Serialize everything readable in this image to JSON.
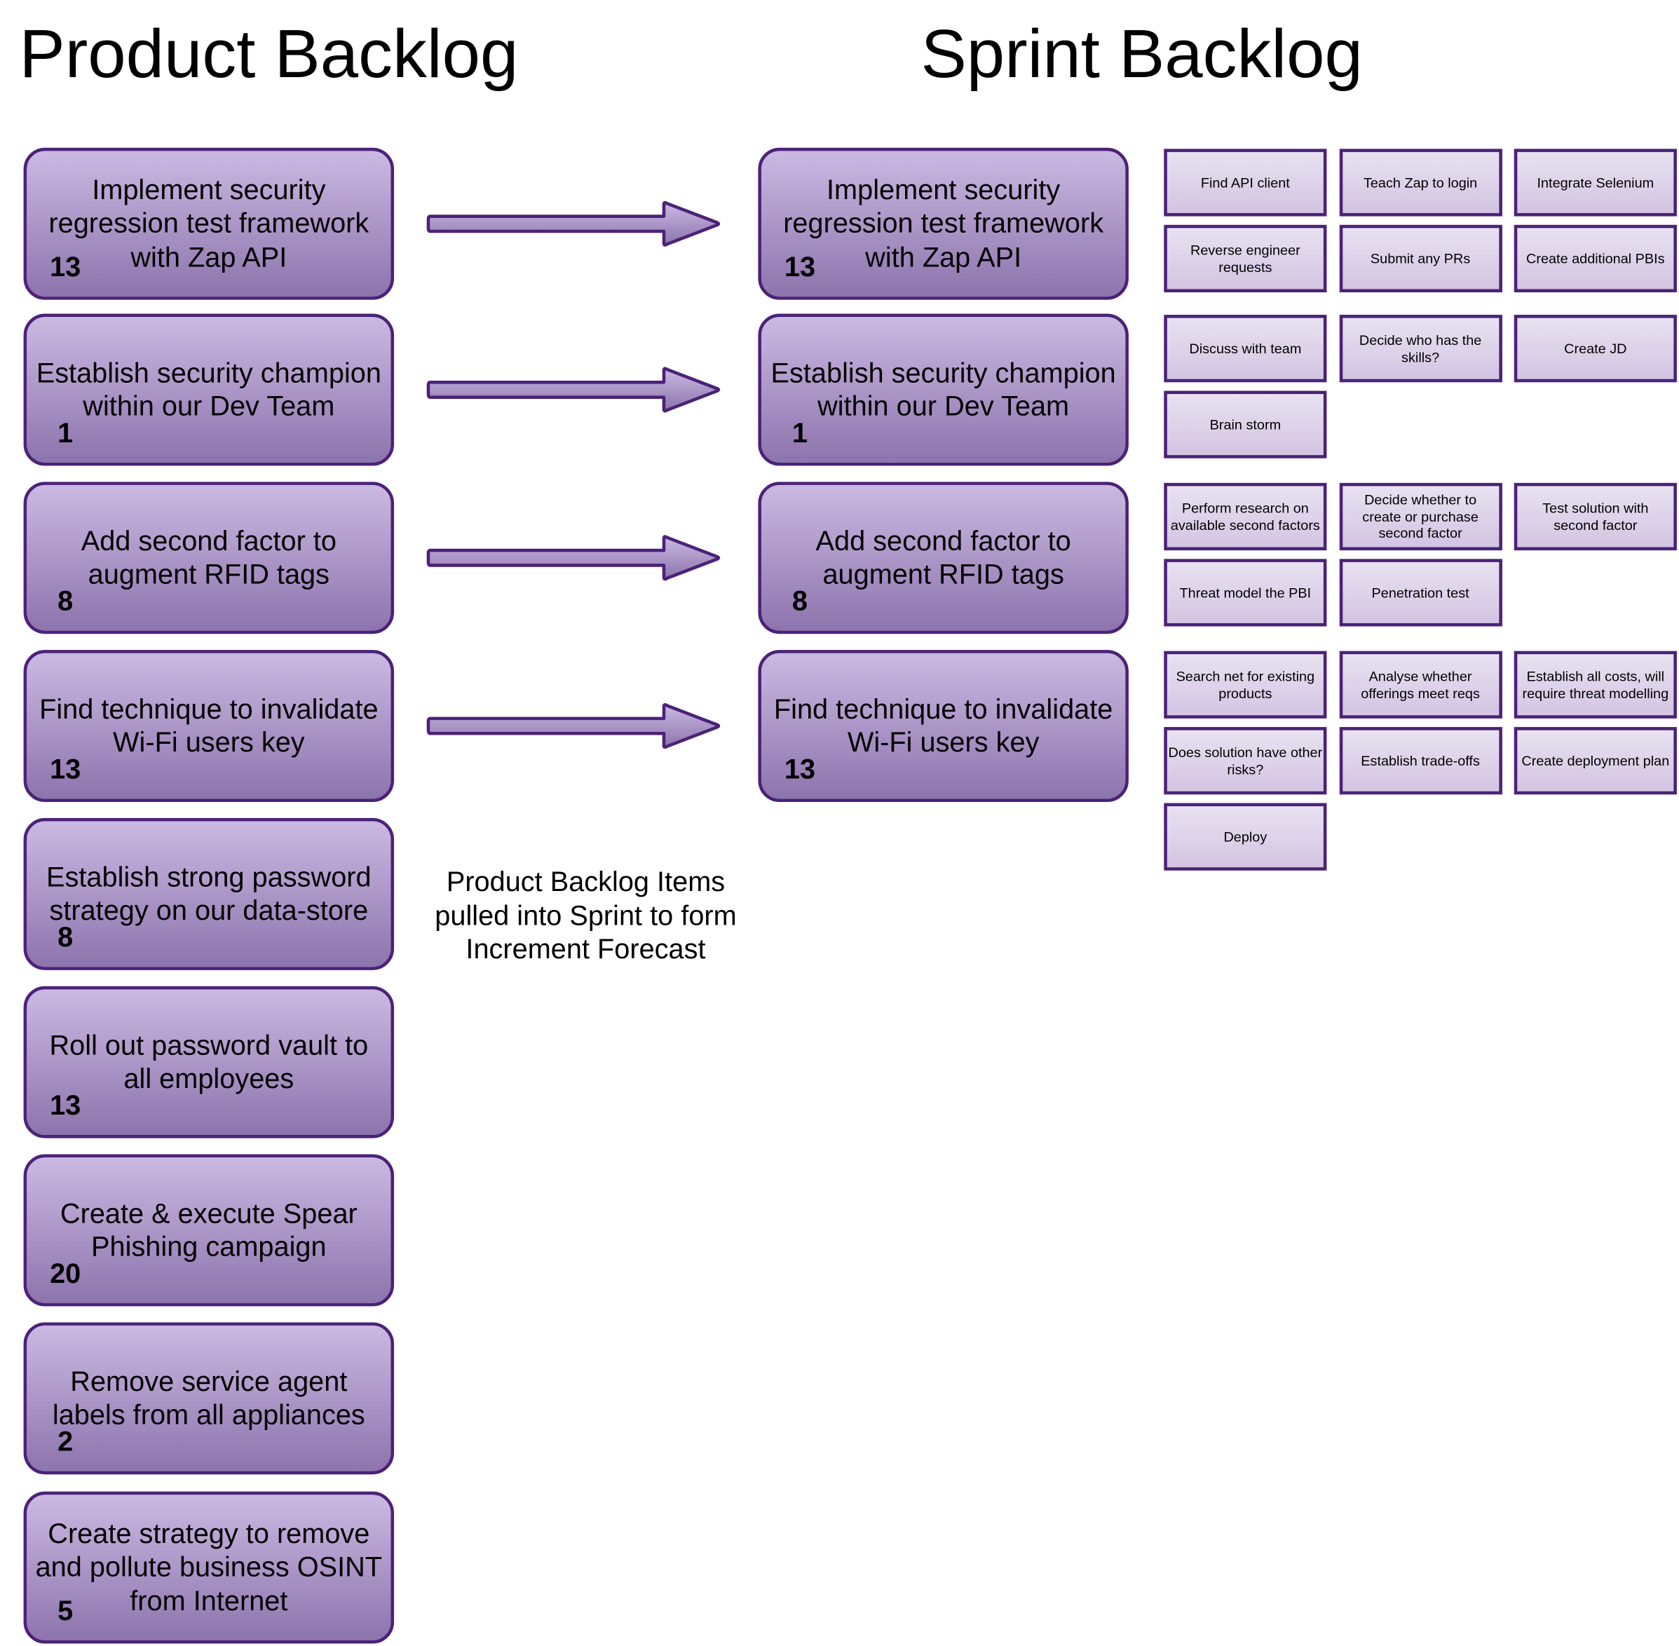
{
  "product_backlog": {
    "title": "Product Backlog",
    "items": [
      {
        "text": "Implement security regression test framework with Zap API",
        "points": "13"
      },
      {
        "text": "Establish security champion within our Dev Team",
        "points": "1"
      },
      {
        "text": "Add second factor to augment RFID tags",
        "points": "8"
      },
      {
        "text": "Find technique to invalidate Wi-Fi users key",
        "points": "13"
      },
      {
        "text": "Establish strong password strategy on our data-store",
        "points": "8"
      },
      {
        "text": "Roll out password vault to all employees",
        "points": "13"
      },
      {
        "text": "Create & execute Spear Phishing campaign",
        "points": "20"
      },
      {
        "text": "Remove service agent labels from all appliances",
        "points": "2"
      },
      {
        "text": "Create strategy to remove and pollute business OSINT from Internet",
        "points": "5"
      }
    ]
  },
  "caption": "Product Backlog Items pulled into Sprint to form Increment Forecast",
  "sprint_backlog": {
    "title": "Sprint Backlog",
    "items": [
      {
        "text": "Implement security regression test framework with Zap API",
        "points": "13",
        "tasks": [
          "Find API client",
          "Teach Zap to login",
          "Integrate Selenium",
          "Reverse engineer requests",
          "Submit any PRs",
          "Create additional PBIs"
        ]
      },
      {
        "text": "Establish security champion within our Dev Team",
        "points": "1",
        "tasks": [
          "Discuss with team",
          "Decide who has the skills?",
          "Create JD",
          "Brain storm"
        ]
      },
      {
        "text": "Add second factor to augment RFID tags",
        "points": "8",
        "tasks": [
          "Perform research on available second factors",
          "Decide whether to create or purchase second factor",
          "Test solution with second factor",
          "Threat model the PBI",
          "Penetration test"
        ]
      },
      {
        "text": "Find technique to invalidate Wi-Fi users key",
        "points": "13",
        "tasks": [
          "Search net for existing products",
          "Analyse whether offerings meet reqs",
          "Establish all costs, will require threat modelling",
          "Does solution have other risks?",
          "Establish trade-offs",
          "Create deployment plan",
          "Deploy"
        ]
      }
    ]
  },
  "colors": {
    "border": "#4b2278",
    "card_top": "#cbb9e2",
    "card_bottom": "#8d74ad",
    "task_top": "#e8e2f1",
    "task_bottom": "#d3c4e2"
  }
}
